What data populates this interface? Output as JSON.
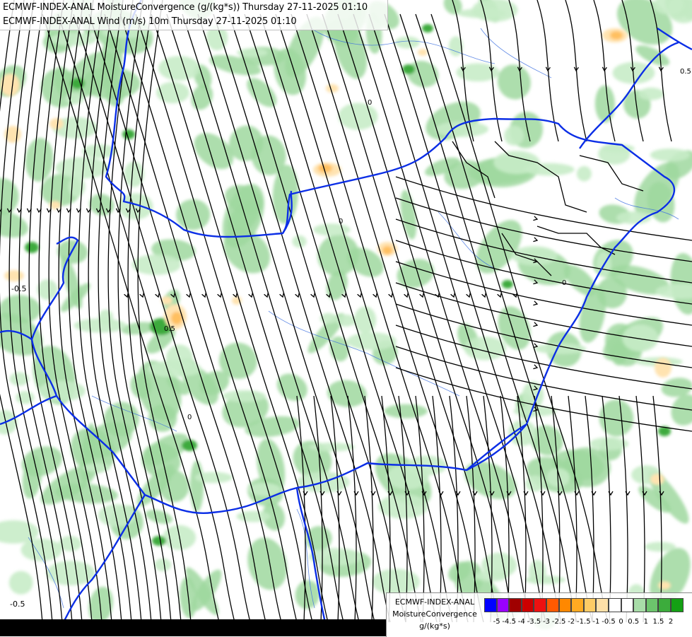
{
  "header": {
    "line1": "ECMWF-INDEX-ANAL MoistureConvergence (g/(kg*s)) Thursday 27-11-2025 01:10",
    "line2": "ECMWF-INDEX-ANAL Wind (m/s) 10m Thursday 27-11-2025 01:10"
  },
  "legend": {
    "title_line1": "ECMWF-INDEX-ANAL",
    "title_line2": "MoistureConvergence",
    "unit": "g/(kg*s)",
    "colors": [
      "#0000ff",
      "#9900ff",
      "#a00000",
      "#cc0000",
      "#ee1111",
      "#ff5a00",
      "#ff8800",
      "#ffaa22",
      "#ffcc66",
      "#ffe0a8",
      "#ffffff",
      "#ffffff",
      "#a8dca8",
      "#6cc46c",
      "#3cac3c",
      "#14a014"
    ],
    "tick_labels": [
      "-5",
      "-4.5",
      "-4",
      "-3.5",
      "-3",
      "-2.5",
      "-2",
      "-1.5",
      "-1",
      "-0.5",
      "0",
      "0.5",
      "1",
      "1.5",
      "2"
    ]
  },
  "map_labels": [
    {
      "id": "contour-label-minus-0-5-west",
      "text": "-0.5"
    },
    {
      "id": "contour-label-minus-0-5-southwest",
      "text": "-0.5"
    },
    {
      "id": "contour-label-0-north",
      "text": "0"
    },
    {
      "id": "contour-label-0-center",
      "text": "0"
    },
    {
      "id": "contour-label-0-east",
      "text": "0"
    },
    {
      "id": "contour-label-0-south",
      "text": "0"
    },
    {
      "id": "contour-label-0-5-northeast",
      "text": "0.5"
    },
    {
      "id": "contour-label-0-5-center",
      "text": "0.5"
    }
  ],
  "colors": {
    "border": "#0b2ee6",
    "river": "#3b6ee0",
    "streamline": "#000000",
    "convergence_light_green": "#c8ecc8",
    "convergence_green": "#9fd89f",
    "convergence_dark_green": "#3caa3c",
    "divergence_light_orange": "#ffe3b0",
    "divergence_orange": "#ffc060"
  }
}
